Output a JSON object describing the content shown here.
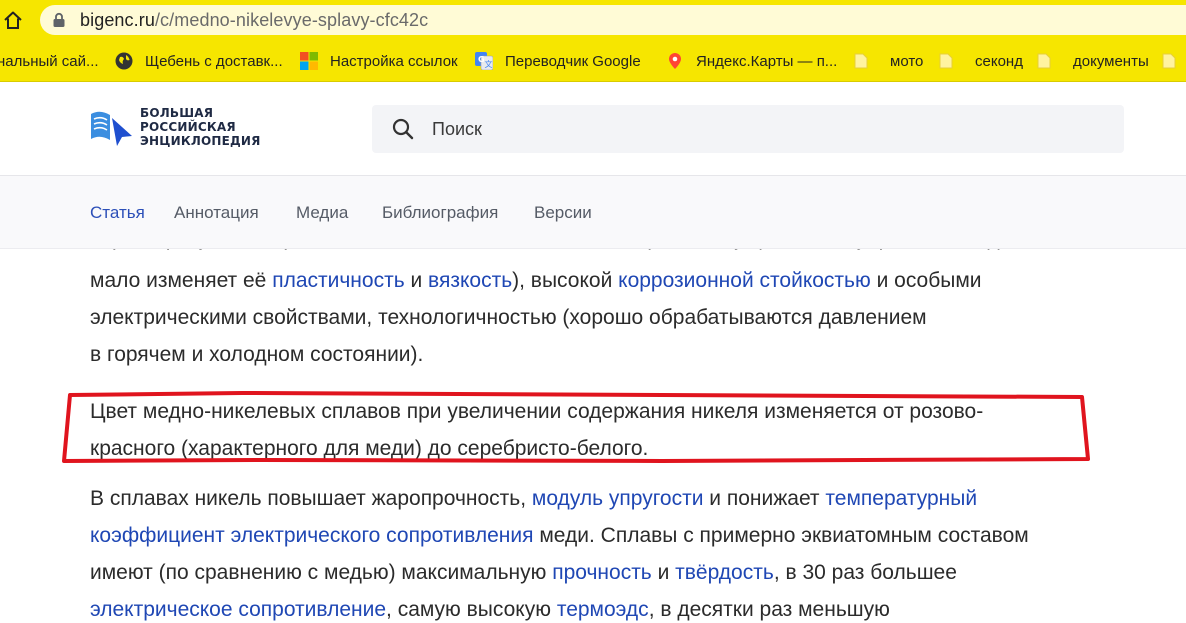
{
  "browser": {
    "url_domain": "bigenc.ru",
    "url_path": "/c/medno-nikelevye-splavy-cfc42c"
  },
  "bookmarks": [
    {
      "label": "нальный сай...",
      "icon": "none"
    },
    {
      "label": "Щебень с доставк...",
      "icon": "globe-icon"
    },
    {
      "label": "Настройка ссылок",
      "icon": "windows-logo-icon"
    },
    {
      "label": "Переводчик Google",
      "icon": "google-translate-icon"
    },
    {
      "label": "Яндекс.Карты — п...",
      "icon": "map-pin-icon"
    },
    {
      "label": "мото",
      "icon": "folder-icon"
    },
    {
      "label": "секонд",
      "icon": "folder-icon"
    },
    {
      "label": "документы",
      "icon": "folder-icon"
    }
  ],
  "site": {
    "logo_line1": "БОЛЬШАЯ",
    "logo_line2": "РОССИЙСКАЯ",
    "logo_line3": "ЭНЦИКЛОПЕДИЯ",
    "search_placeholder": "Поиск"
  },
  "tabs": [
    {
      "label": "Статья",
      "active": true
    },
    {
      "label": "Аннотация",
      "active": false
    },
    {
      "label": "Медиа",
      "active": false
    },
    {
      "label": "Библиография",
      "active": false
    },
    {
      "label": "Версии",
      "active": false
    }
  ],
  "article": {
    "clipped_line": "характеризуются хорошими механическими свойствами (никель существенно упрочняет медь,",
    "p1": {
      "l1_a": "мало изменяет её ",
      "l1_link1": "пластичность",
      "l1_b": " и ",
      "l1_link2": "вязкость",
      "l1_c": "), высокой ",
      "l1_link3": "коррозионной стойкостью",
      "l1_d": " и особыми",
      "l2": "электрическими свойствами, технологичностью (хорошо обрабатываются давлением",
      "l3": "в горячем и холодном состоянии)."
    },
    "p2": {
      "l1": "Цвет медно-никелевых сплавов при увеличении содержания никеля изменяется от розово-",
      "l2": "красного (характерного для меди) до серебристо-белого."
    },
    "p3": {
      "l1_a": "В сплавах никель повышает жаропрочность, ",
      "l1_link1": "модуль упругости",
      "l1_b": " и понижает ",
      "l1_link2": "температурный",
      "l2_link1": "коэффициент электрического сопротивления",
      "l2_a": " меди. Сплавы с примерно эквиатомным составом",
      "l3_a": "имеют (по сравнению с медью) максимальную ",
      "l3_link1": "прочность",
      "l3_b": " и ",
      "l3_link2": "твёрдость",
      "l3_c": ", в 30 раз большее",
      "l4_link1": "электрическое сопротивление",
      "l4_a": ", самую высокую ",
      "l4_link2": "термоэдс",
      "l4_b": ", в десятки раз меньшую"
    }
  },
  "colors": {
    "browser_bar": "#f6e600",
    "link": "#1f47b4",
    "active_tab": "#2c4fb8",
    "highlight_frame": "#e0141e"
  }
}
